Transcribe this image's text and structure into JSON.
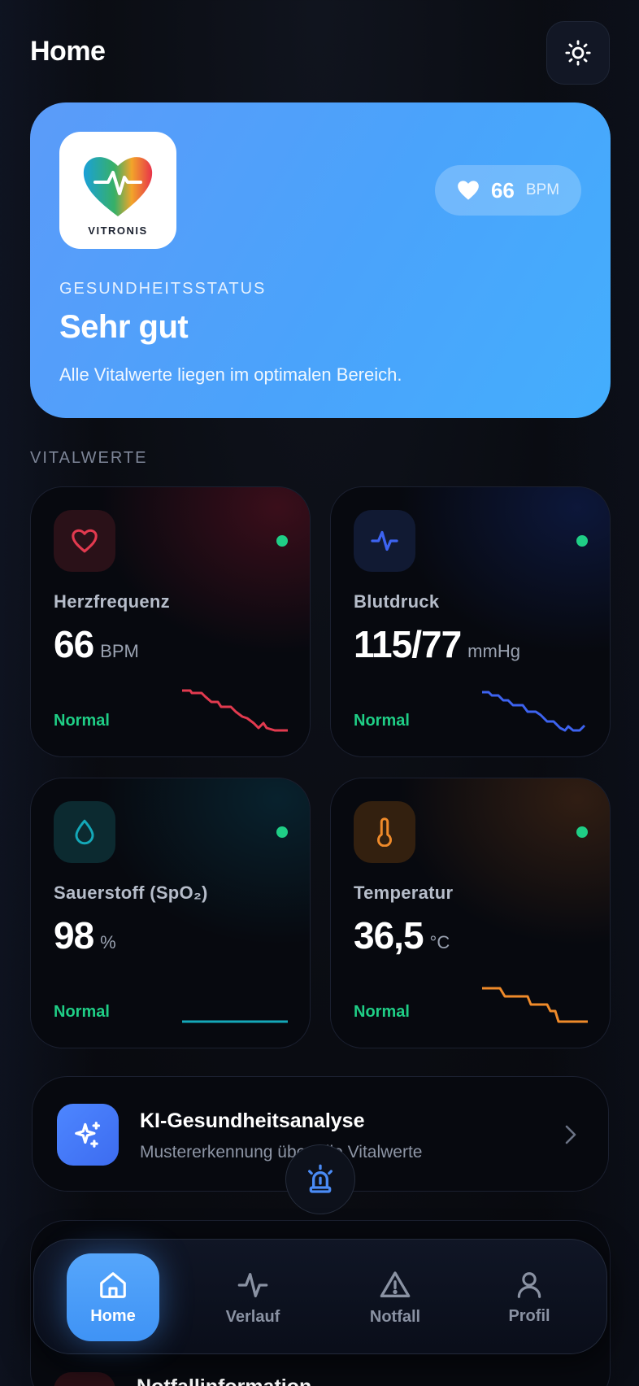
{
  "header": {
    "title": "Home",
    "theme_icon": "sun-icon"
  },
  "hero": {
    "logo_text": "VITRONIS",
    "bpm_value": "66",
    "bpm_unit": "BPM",
    "label": "GESUNDHEITSSTATUS",
    "status": "Sehr gut",
    "description": "Alle Vitalwerte liegen im optimalen Bereich."
  },
  "vitals": {
    "section_label": "VITALWERTE",
    "cards": [
      {
        "title": "Herzfrequenz",
        "value": "66",
        "unit": "BPM",
        "status": "Normal",
        "icon": "heart-icon",
        "accent": "#e23a4f"
      },
      {
        "title": "Blutdruck",
        "value": "115/77",
        "unit": "mmHg",
        "status": "Normal",
        "icon": "activity-icon",
        "accent": "#3d63f0"
      },
      {
        "title": "Sauerstoff (SpO₂)",
        "value": "98",
        "unit": "%",
        "status": "Normal",
        "icon": "droplet-icon",
        "accent": "#14a8b8"
      },
      {
        "title": "Temperatur",
        "value": "36,5",
        "unit": "°C",
        "status": "Normal",
        "icon": "thermometer-icon",
        "accent": "#ef8a2a"
      }
    ]
  },
  "ai_analysis": {
    "title": "KI-Gesundheitsanalyse",
    "subtitle": "Mustererkennung über alle Vitalwerte",
    "icon": "sparkles-icon"
  },
  "emergency_card": {
    "title": "Notfallinformation"
  },
  "tabbar": {
    "tabs": [
      {
        "label": "Home",
        "icon": "home-icon",
        "active": true
      },
      {
        "label": "Verlauf",
        "icon": "activity-icon",
        "active": false
      },
      {
        "label": "Notfall",
        "icon": "warning-icon",
        "active": false
      },
      {
        "label": "Profil",
        "icon": "user-icon",
        "active": false
      }
    ]
  },
  "colors": {
    "status_green": "#1fce86",
    "hero_blue": "#4aa3fb",
    "background": "#0a0c12"
  }
}
